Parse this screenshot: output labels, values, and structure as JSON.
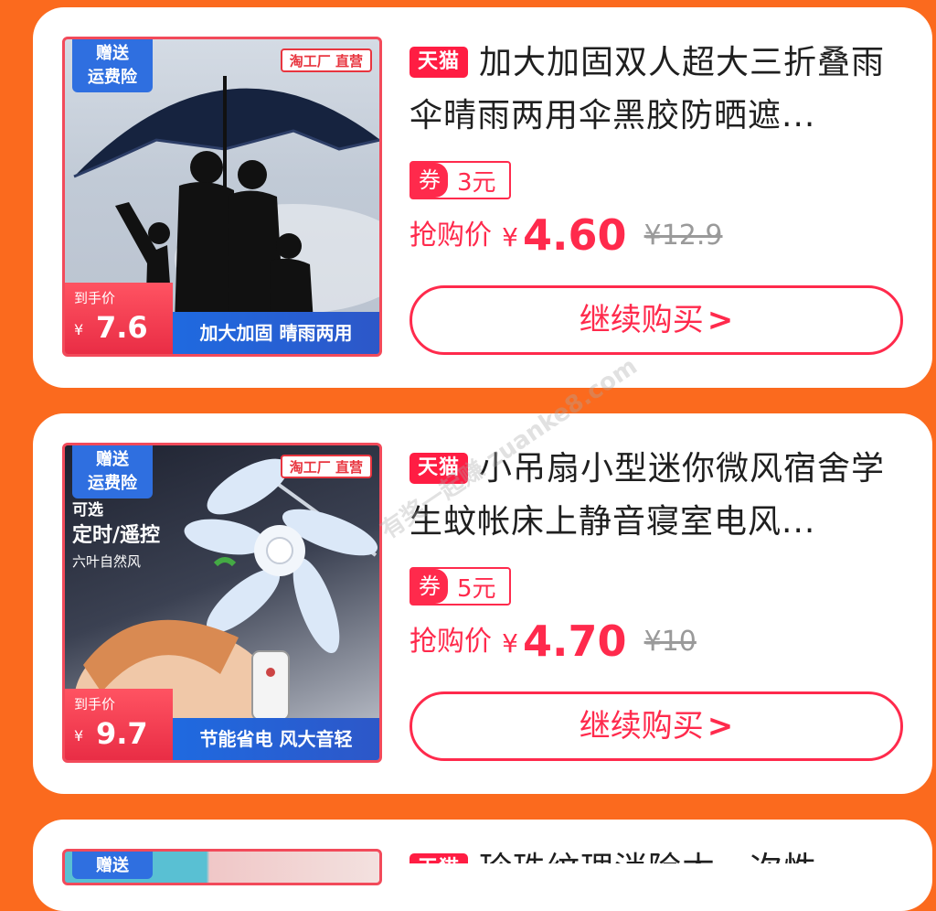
{
  "products": [
    {
      "gift_badge_line1": "赠送",
      "gift_badge_line2": "运费险",
      "factory_badge": "淘工厂 直营",
      "hand_price_label": "到手价",
      "hand_price_currency": "¥",
      "hand_price": "7.6",
      "banner_text": "加大加固 晴雨两用",
      "platform_tag": "天猫",
      "title": "加大加固双人超大三折叠雨伞晴雨两用伞黑胶防晒遮...",
      "coupon_label": "券",
      "coupon_amount": "3元",
      "price_label": "抢购价",
      "currency": "¥",
      "price": "4.60",
      "original_price": "¥12.9",
      "buy_button": "继续购买"
    },
    {
      "gift_badge_line1": "赠送",
      "gift_badge_line2": "运费险",
      "factory_badge": "淘工厂 直营",
      "feature_small": "可选",
      "feature_big": "定时/遥控",
      "feature_sub": "六叶自然风",
      "hand_price_label": "到手价",
      "hand_price_currency": "¥",
      "hand_price": "9.7",
      "banner_text": "节能省电 风大音轻",
      "platform_tag": "天猫",
      "title": "小吊扇小型迷你微风宿舍学生蚊帐床上静音寝室电风...",
      "coupon_label": "券",
      "coupon_amount": "5元",
      "price_label": "抢购价",
      "currency": "¥",
      "price": "4.70",
      "original_price": "¥10",
      "buy_button": "继续购买"
    },
    {
      "gift_badge_line1": "赠送",
      "platform_tag": "天猫",
      "title_partial": "珍珠纹理消除木一次性纯..."
    }
  ],
  "watermark": "有奖一起赚 zuanke8.com",
  "colors": {
    "background": "#fb6a1e",
    "accent": "#ff2a4c",
    "tmall": "#ff1d43",
    "badge_blue": "#2f6fe0"
  }
}
